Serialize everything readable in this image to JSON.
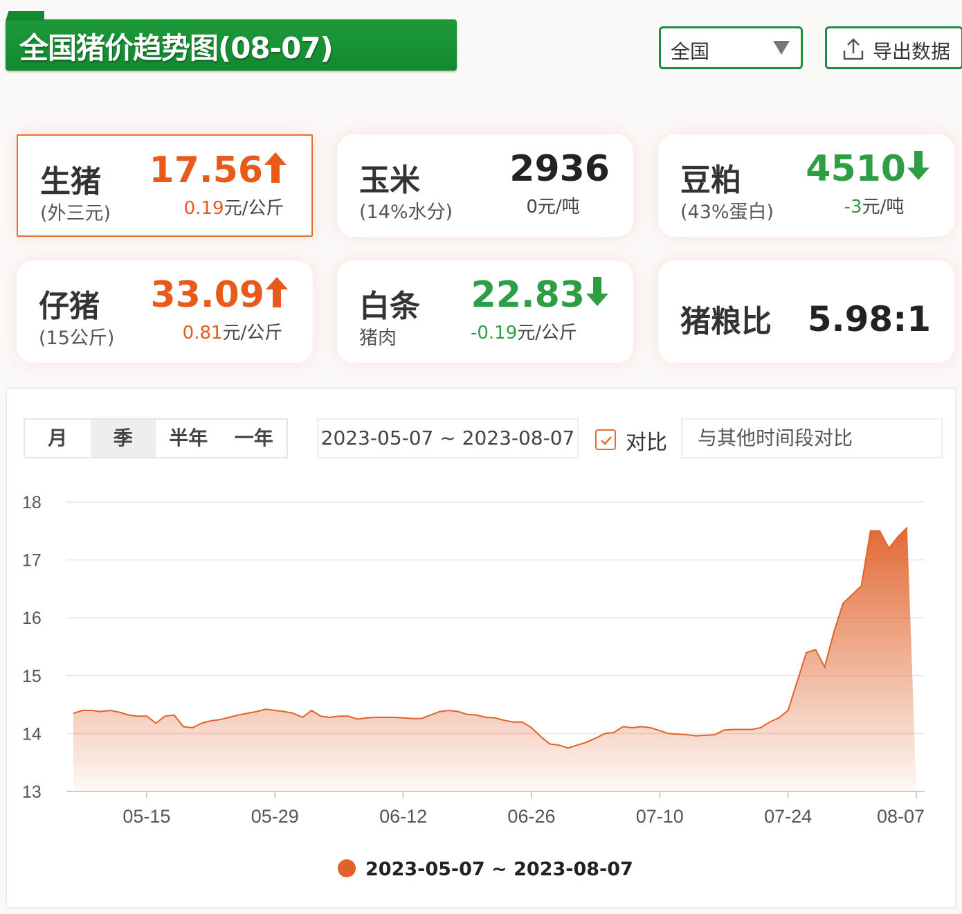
{
  "header": {
    "title": "全国猪价趋势图(08-07)",
    "region_select": "全国",
    "export_label": "导出数据"
  },
  "cards": [
    {
      "name": "生猪",
      "sub": "(外三元)",
      "value": "17.56",
      "trend": "up",
      "change": "0.19",
      "unit": "元/公斤"
    },
    {
      "name": "玉米",
      "sub": "(14%水分)",
      "value": "2936",
      "trend": "flat",
      "change": "0",
      "unit": "元/吨"
    },
    {
      "name": "豆粕",
      "sub": "(43%蛋白)",
      "value": "4510",
      "trend": "down",
      "change": "-3",
      "unit": "元/吨"
    },
    {
      "name": "仔猪",
      "sub": "(15公斤)",
      "value": "33.09",
      "trend": "up",
      "change": "0.81",
      "unit": "元/公斤"
    },
    {
      "name": "白条",
      "sub": "猪肉",
      "value": "22.83",
      "trend": "down",
      "change": "-0.19",
      "unit": "元/公斤"
    },
    {
      "name": "猪粮比",
      "value": "5.98:1"
    }
  ],
  "controls": {
    "period_tabs": [
      "月",
      "季",
      "半年",
      "一年"
    ],
    "active_tab": "季",
    "date_range": "2023-05-07 ~ 2023-08-07",
    "compare_label": "对比",
    "compare_checked": true,
    "compare_placeholder": "与其他时间段对比"
  },
  "colors": {
    "brand_green": "#1a9438",
    "up": "#e85a1a",
    "down": "#2e9e44",
    "series": "#e0622a"
  },
  "chart_data": {
    "type": "area",
    "x": [
      "2023-05-07",
      "2023-05-08",
      "2023-05-09",
      "2023-05-10",
      "2023-05-11",
      "2023-05-12",
      "2023-05-13",
      "2023-05-14",
      "2023-05-15",
      "2023-05-16",
      "2023-05-17",
      "2023-05-18",
      "2023-05-19",
      "2023-05-20",
      "2023-05-21",
      "2023-05-22",
      "2023-05-23",
      "2023-05-24",
      "2023-05-25",
      "2023-05-26",
      "2023-05-27",
      "2023-05-28",
      "2023-05-29",
      "2023-05-30",
      "2023-05-31",
      "2023-06-01",
      "2023-06-02",
      "2023-06-03",
      "2023-06-04",
      "2023-06-05",
      "2023-06-06",
      "2023-06-07",
      "2023-06-08",
      "2023-06-09",
      "2023-06-10",
      "2023-06-11",
      "2023-06-12",
      "2023-06-13",
      "2023-06-14",
      "2023-06-15",
      "2023-06-16",
      "2023-06-17",
      "2023-06-18",
      "2023-06-19",
      "2023-06-20",
      "2023-06-21",
      "2023-06-22",
      "2023-06-23",
      "2023-06-24",
      "2023-06-25",
      "2023-06-26",
      "2023-06-27",
      "2023-06-28",
      "2023-06-29",
      "2023-06-30",
      "2023-07-01",
      "2023-07-02",
      "2023-07-03",
      "2023-07-04",
      "2023-07-05",
      "2023-07-06",
      "2023-07-07",
      "2023-07-08",
      "2023-07-09",
      "2023-07-10",
      "2023-07-11",
      "2023-07-12",
      "2023-07-13",
      "2023-07-14",
      "2023-07-15",
      "2023-07-16",
      "2023-07-17",
      "2023-07-18",
      "2023-07-19",
      "2023-07-20",
      "2023-07-21",
      "2023-07-22",
      "2023-07-23",
      "2023-07-24",
      "2023-07-25",
      "2023-07-26",
      "2023-07-27",
      "2023-07-28",
      "2023-07-29",
      "2023-07-30",
      "2023-07-31",
      "2023-08-01",
      "2023-08-02",
      "2023-08-03",
      "2023-08-04",
      "2023-08-05",
      "2023-08-06",
      "2023-08-07"
    ],
    "series": [
      {
        "name": "2023-05-07 ~ 2023-08-07",
        "values": [
          14.35,
          14.4,
          14.4,
          14.38,
          14.4,
          14.37,
          14.32,
          14.3,
          14.3,
          14.18,
          14.3,
          14.32,
          14.12,
          14.1,
          14.18,
          14.22,
          14.24,
          14.28,
          14.32,
          14.35,
          14.38,
          14.42,
          14.4,
          14.38,
          14.35,
          14.28,
          14.4,
          14.3,
          14.28,
          14.3,
          14.3,
          14.25,
          14.27,
          14.28,
          14.28,
          14.28,
          14.27,
          14.26,
          14.26,
          14.32,
          14.38,
          14.4,
          14.38,
          14.33,
          14.32,
          14.28,
          14.27,
          14.23,
          14.2,
          14.2,
          14.1,
          13.95,
          13.82,
          13.8,
          13.75,
          13.8,
          13.85,
          13.92,
          14.0,
          14.02,
          14.12,
          14.1,
          14.12,
          14.1,
          14.05,
          14.0,
          13.99,
          13.98,
          13.96,
          13.97,
          13.98,
          14.06,
          14.07,
          14.07,
          14.07,
          14.1,
          14.2,
          14.27,
          14.4,
          14.9,
          15.4,
          15.45,
          15.15,
          15.75,
          16.25,
          16.4,
          16.55,
          17.5,
          17.5,
          17.2,
          17.4,
          17.56
        ]
      }
    ],
    "ylim": [
      13,
      18
    ],
    "yticks": [
      13,
      14,
      15,
      16,
      17,
      18
    ],
    "xtick_labels": [
      "05-15",
      "05-29",
      "06-12",
      "06-26",
      "07-10",
      "07-24",
      "08-07"
    ],
    "xtick_dates": [
      "2023-05-15",
      "2023-05-29",
      "2023-06-12",
      "2023-06-26",
      "2023-07-10",
      "2023-07-24",
      "2023-08-07"
    ],
    "grid": true,
    "legend": "bottom"
  }
}
